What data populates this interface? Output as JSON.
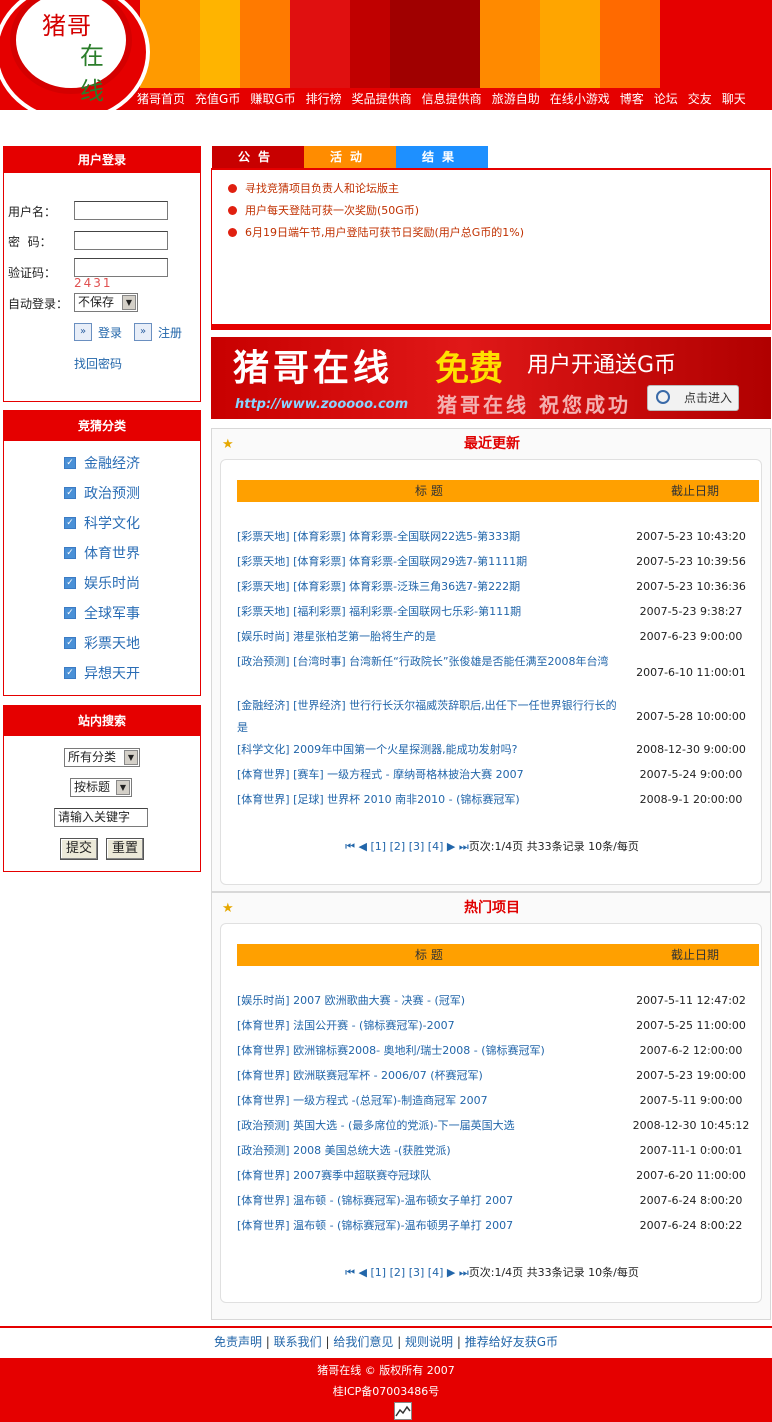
{
  "logo": {
    "line1": "猪哥",
    "line2": "在线"
  },
  "nav": [
    "猪哥首页",
    "充值G币",
    "赚取G币",
    "排行榜",
    "奖品提供商",
    "信息提供商",
    "旅游自助",
    "在线小游戏",
    "博客",
    "论坛",
    "交友",
    "聊天"
  ],
  "login": {
    "title": "用户登录",
    "username_label": "用户名：",
    "password_label": "密  码：",
    "captcha_label": "验证码：",
    "captcha_value": "2431",
    "auto_login_label": "自动登录：",
    "auto_login_value": "不保存",
    "login_label": "登录",
    "register_label": "注册",
    "recover_label": "找回密码"
  },
  "categories": {
    "title": "竞猜分类",
    "items": [
      "金融经济",
      "政治预测",
      "科学文化",
      "体育世界",
      "娱乐时尚",
      "全球军事",
      "彩票天地",
      "异想天开"
    ]
  },
  "search": {
    "title": "站内搜索",
    "category_value": "所有分类",
    "mode_value": "按标题",
    "keyword_value": "请输入关键字",
    "submit_label": "提交",
    "reset_label": "重置"
  },
  "notice": {
    "tabs": [
      "公告",
      "活动",
      "结果"
    ],
    "tab_colors": [
      "#c80000",
      "#ff8c00",
      "#1e90ff"
    ],
    "items": [
      "寻找竞猜项目负责人和论坛版主",
      "用户每天登陆可获一次奖励(50G币)",
      "6月19日端午节,用户登陆可获节日奖励(用户总G币的1%)"
    ]
  },
  "banner": {
    "title": "猪哥在线",
    "free": "免费",
    "subtitle": "用户开通送G币",
    "url": "http://www.zooooo.com",
    "slogan": "猪哥在线 祝您成功",
    "enter": "点击进入"
  },
  "recent": {
    "title": "最近更新",
    "col_title": "标 题",
    "col_date": "截止日期",
    "rows": [
      {
        "title": "[彩票天地] [体育彩票] 体育彩票-全国联网22选5-第333期",
        "date": "2007-5-23 10:43:20"
      },
      {
        "title": "[彩票天地] [体育彩票] 体育彩票-全国联网29选7-第1111期",
        "date": "2007-5-23 10:39:56"
      },
      {
        "title": "[彩票天地] [体育彩票] 体育彩票-泛珠三角36选7-第222期",
        "date": "2007-5-23 10:36:36"
      },
      {
        "title": "[彩票天地] [福利彩票] 福利彩票-全国联网七乐彩-第111期",
        "date": "2007-5-23 9:38:27"
      },
      {
        "title": "[娱乐时尚] 港星张柏芝第一胎将生产的是",
        "date": "2007-6-23 9:00:00"
      },
      {
        "title": "[政治预测] [台湾时事] 台湾新任“行政院长”张俊雄是否能任满至2008年台湾",
        "date": "2007-6-10 11:00:01"
      },
      {
        "title": "[金融经济] [世界经济] 世行行长沃尔福威茨辞职后,出任下一任世界银行行长的是",
        "date": "2007-5-28 10:00:00"
      },
      {
        "title": "[科学文化] 2009年中国第一个火星探测器,能成功发射吗?",
        "date": "2008-12-30 9:00:00"
      },
      {
        "title": "[体育世界] [赛车] 一级方程式 - 摩纳哥格林披治大赛 2007",
        "date": "2007-5-24 9:00:00"
      },
      {
        "title": "[体育世界] [足球] 世界杯 2010 南非2010 - (锦标赛冠军)",
        "date": "2008-9-1 20:00:00"
      }
    ],
    "pager": {
      "pages": [
        "[1]",
        "[2]",
        "[3]",
        "[4]"
      ],
      "info": "页次:1/4页 共33条记录 10条/每页"
    }
  },
  "hot": {
    "title": "热门项目",
    "col_title": "标 题",
    "col_date": "截止日期",
    "rows": [
      {
        "title": "[娱乐时尚] 2007 欧洲歌曲大赛 - 决赛 - (冠军)",
        "date": "2007-5-11 12:47:02"
      },
      {
        "title": "[体育世界] 法国公开赛 - (锦标赛冠军)-2007",
        "date": "2007-5-25 11:00:00"
      },
      {
        "title": "[体育世界] 欧洲锦标赛2008- 奥地利/瑞士2008 - (锦标赛冠军)",
        "date": "2007-6-2 12:00:00"
      },
      {
        "title": "[体育世界] 欧洲联赛冠军杯 - 2006/07 (杯赛冠军)",
        "date": "2007-5-23 19:00:00"
      },
      {
        "title": "[体育世界] 一级方程式 -(总冠军)-制造商冠军 2007",
        "date": "2007-5-11 9:00:00"
      },
      {
        "title": "[政治预测] 英国大选 - (最多席位的党派)-下一届英国大选",
        "date": "2008-12-30 10:45:12"
      },
      {
        "title": "[政治预测] 2008 美国总统大选 -(获胜党派)",
        "date": "2007-11-1 0:00:01"
      },
      {
        "title": "[体育世界] 2007赛季中超联赛夺冠球队",
        "date": "2007-6-20 11:00:00"
      },
      {
        "title": "[体育世界] 温布顿 - (锦标赛冠军)-温布顿女子单打 2007",
        "date": "2007-6-24 8:00:20"
      },
      {
        "title": "[体育世界] 温布顿 - (锦标赛冠军)-温布顿男子单打 2007",
        "date": "2007-6-24 8:00:22"
      }
    ],
    "pager": {
      "pages": [
        "[1]",
        "[2]",
        "[3]",
        "[4]"
      ],
      "info": "页次:1/4页 共33条记录 10条/每页"
    }
  },
  "footer": {
    "links": [
      "免责声明",
      "联系我们",
      "给我们意见",
      "规则说明",
      "推荐给好友获G币"
    ],
    "copyright": "猪哥在线 © 版权所有 2007",
    "icp": "桂ICP备07003486号"
  },
  "colors": {
    "brand_red": "#e50000",
    "table_header": "#ffa000",
    "link_blue": "#2266aa"
  }
}
